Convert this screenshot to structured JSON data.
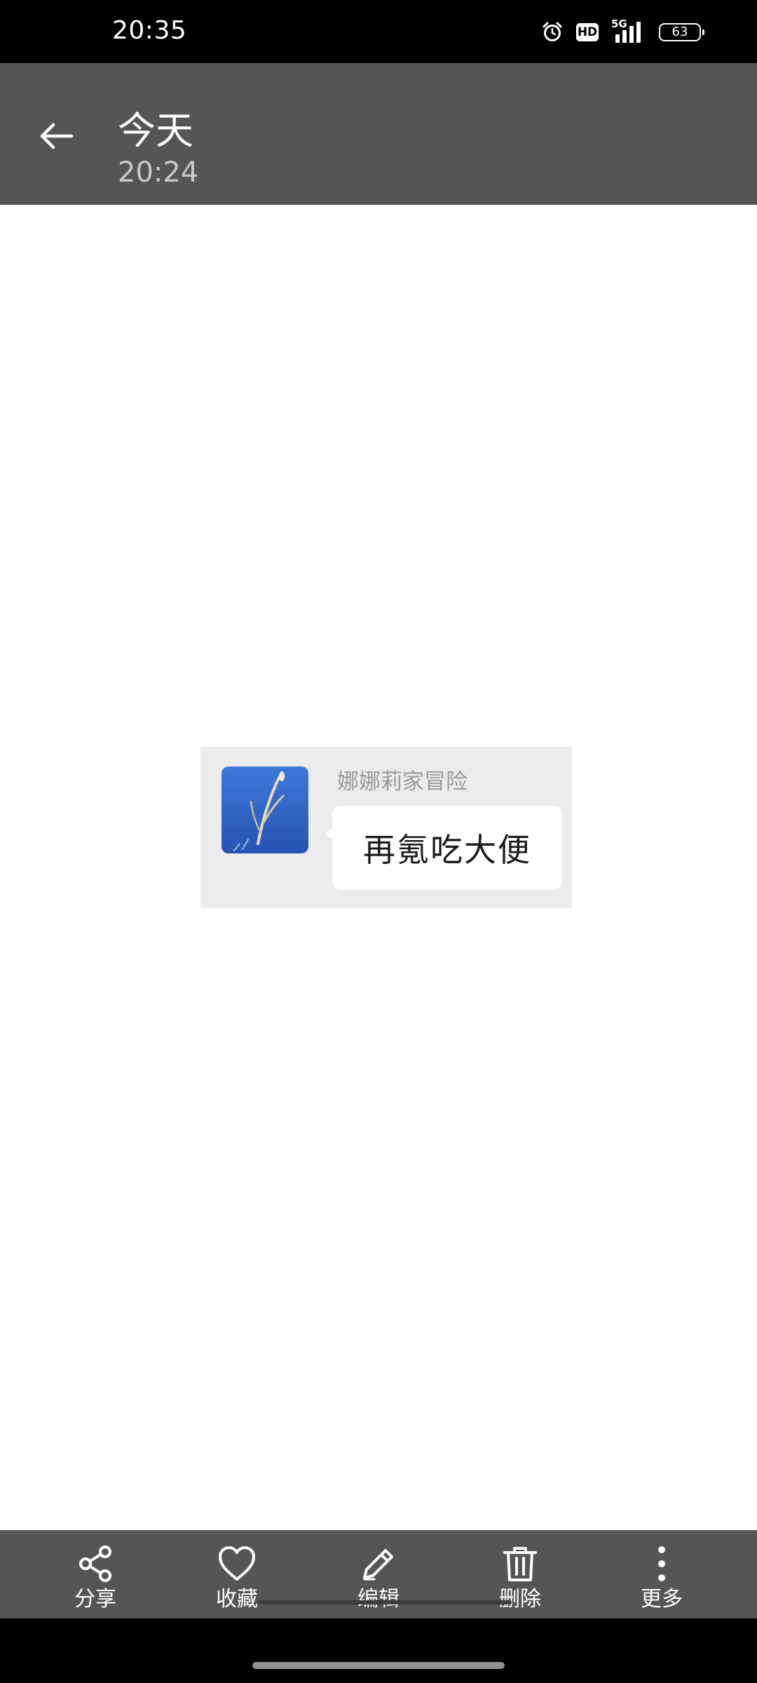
{
  "status_bar": {
    "time": "20:35",
    "hd_label": "HD",
    "network_label": "5G",
    "battery_level": "63"
  },
  "header": {
    "title": "今天",
    "subtitle": "20:24"
  },
  "chat_image": {
    "sender_name": "娜娜莉家冒险",
    "message": "再氪吃大便"
  },
  "actions": [
    {
      "label": "分享",
      "icon": "share-icon"
    },
    {
      "label": "收藏",
      "icon": "heart-icon"
    },
    {
      "label": "编辑",
      "icon": "pencil-icon"
    },
    {
      "label": "删除",
      "icon": "trash-icon"
    },
    {
      "label": "更多",
      "icon": "more-vertical-icon"
    }
  ],
  "colors": {
    "status_bar": "#000000",
    "app_bar": "#555555",
    "action_bar": "#555555",
    "viewer_background": "#ffffff",
    "chat_background": "#ececec",
    "avatar_sky": "#2e63c4"
  }
}
